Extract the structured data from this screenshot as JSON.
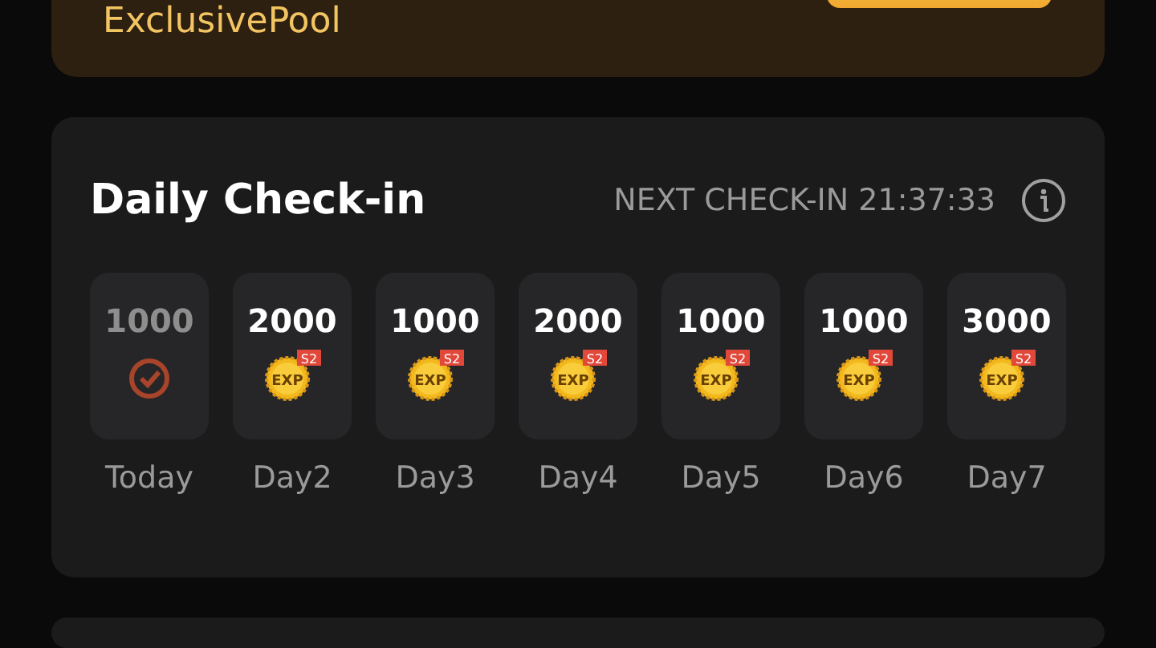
{
  "pool_card": {
    "title": "ExclusivePool"
  },
  "check_in": {
    "title": "Daily Check-in",
    "next_label": "NEXT CHECK-IN 21:37:33",
    "days": [
      {
        "amount": "1000",
        "label": "Today",
        "claimed": true
      },
      {
        "amount": "2000",
        "label": "Day2",
        "claimed": false,
        "coin_label": "EXP",
        "coin_tag": "S2"
      },
      {
        "amount": "1000",
        "label": "Day3",
        "claimed": false,
        "coin_label": "EXP",
        "coin_tag": "S2"
      },
      {
        "amount": "2000",
        "label": "Day4",
        "claimed": false,
        "coin_label": "EXP",
        "coin_tag": "S2"
      },
      {
        "amount": "1000",
        "label": "Day5",
        "claimed": false,
        "coin_label": "EXP",
        "coin_tag": "S2"
      },
      {
        "amount": "1000",
        "label": "Day6",
        "claimed": false,
        "coin_label": "EXP",
        "coin_tag": "S2"
      },
      {
        "amount": "3000",
        "label": "Day7",
        "claimed": false,
        "coin_label": "EXP",
        "coin_tag": "S2"
      }
    ]
  }
}
